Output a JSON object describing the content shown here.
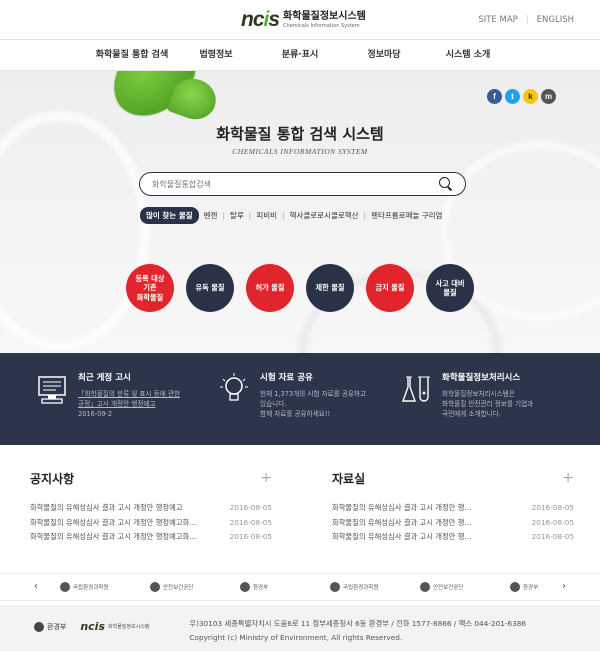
{
  "header": {
    "logo_mark": "ncis",
    "logo_kr": "화학물질정보시스템",
    "logo_en": "Chemicals Information System",
    "sitemap": "SITE MAP",
    "english": "ENGLISH"
  },
  "nav": [
    "화학물질 통합 검색",
    "법령정보",
    "분류·표시",
    "정보마당",
    "시스템 소개"
  ],
  "hero": {
    "title": "화학물질 통합 검색 시스템",
    "subtitle": "CHEMICALS INFORMATION SYSTEM",
    "search_placeholder": "화학물질통합검색",
    "popular_label": "많이 찾는 물질",
    "popular": [
      "벤젠",
      "탈루",
      "피비비",
      "헥사클로로시클로핵산",
      "펜타프롬로페놀 구리염"
    ],
    "circles": [
      {
        "label": "등록 대상\n기존\n화학물질",
        "color": "red"
      },
      {
        "label": "유독 물질",
        "color": "navy"
      },
      {
        "label": "허가 물질",
        "color": "red"
      },
      {
        "label": "제한 물질",
        "color": "navy"
      },
      {
        "label": "금지 물질",
        "color": "red"
      },
      {
        "label": "사고 대비\n물질",
        "color": "navy"
      }
    ],
    "social": [
      "f",
      "t",
      "k",
      "m"
    ]
  },
  "info": [
    {
      "icon": "computer-icon",
      "title": "최근 게정 고시",
      "lines": [
        "「화학물질의 분류 및 표시 등에 관한",
        "규정」고시 개정안 행정예고",
        "2016-09-2"
      ]
    },
    {
      "icon": "lightbulb-icon",
      "title": "시험 자료 공유",
      "lines": [
        "현재 1,373개의 시험 자료를 공유하고",
        "있습니다.",
        "함께 자료를 공유하세요!!"
      ]
    },
    {
      "icon": "flask-icon",
      "title": "화학물질정보처리시스",
      "lines": [
        "화학물질정보처리시스템은",
        "화학물질 안전관리 정보를 기업과",
        "국민에게 소개합니다."
      ]
    }
  ],
  "notice": {
    "title": "공지사항",
    "plus": "+",
    "items": [
      {
        "text": "화학물질의 유해성심사 결과 고시 개정안 행정예고",
        "date": "2016-08-05"
      },
      {
        "text": "화학물질의 유해성심사 결과 고시 개정안 행정예고화…",
        "date": "2016-08-05"
      },
      {
        "text": "화학물질의 유해성심사 결과 고시 개정안 행정예고화…",
        "date": "2016-08-05"
      }
    ]
  },
  "archive": {
    "title": "자료실",
    "plus": "+",
    "items": [
      {
        "text": "화학물질의 유해성심사 결과 고시 개정안 행…",
        "date": "2016-08-05"
      },
      {
        "text": "화학물질의 유해성심사 결과 고시 개정안 행…",
        "date": "2016-08-05"
      },
      {
        "text": "화학물질의 유해성심사 결과 고시 개정안 행…",
        "date": "2016-08-05"
      }
    ]
  },
  "banners": [
    "국립환경과학원",
    "안전보건공단",
    "환경부",
    "국립환경과학원",
    "안전보건공단",
    "환경부"
  ],
  "footer": {
    "moe": "환경부",
    "ncis": "ncis",
    "ncis_sub": "화학물질정보시스템",
    "address": "우)30103 세종특별자치시 도움6로 11 정부세종청사 6동 환경부 / 전화 1577-8866 / 팩스 044-201-6386",
    "copyright": "Copyright (c) Ministry of Environment, All rights Reserved."
  }
}
